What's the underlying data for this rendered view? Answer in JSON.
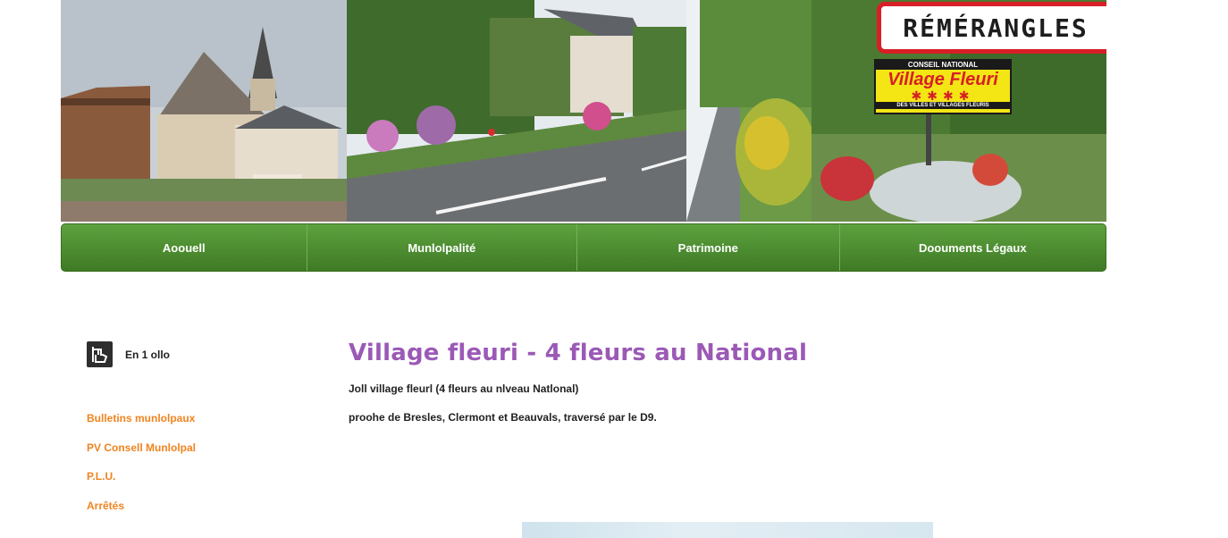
{
  "banner": {
    "sign_village_name": "RÉMÉRANGLES",
    "sign_top": "CONSEIL NATIONAL",
    "sign_main": "Village Fleuri",
    "sign_stars": "✱✱✱✱",
    "sign_bottom": "DES VILLES ET VILLAGES FLEURIS"
  },
  "nav": {
    "items": [
      {
        "label": "Aoouell"
      },
      {
        "label": "Munlolpalité"
      },
      {
        "label": "Patrimoine"
      },
      {
        "label": "Doouments Légaux"
      }
    ]
  },
  "sidebar": {
    "quick_label": "En 1 ollo",
    "links": [
      {
        "label": "Bulletins munlolpaux"
      },
      {
        "label": "PV Consell Munlolpal"
      },
      {
        "label": "P.L.U."
      },
      {
        "label": "Arrêtés"
      }
    ]
  },
  "main": {
    "title": "Village fleuri - 4 fleurs au National",
    "paragraphs": [
      "Joll village fleurl (4 fleurs au nlveau Natlonal)",
      "proohe de Bresles, Clermont et Beauvals, traversé par le D9."
    ]
  },
  "colors": {
    "nav_green": "#4e8f31",
    "title_purple": "#9b59b6",
    "link_orange": "#f0831f"
  },
  "icons": {
    "quick_icon": "hand-click-icon"
  }
}
